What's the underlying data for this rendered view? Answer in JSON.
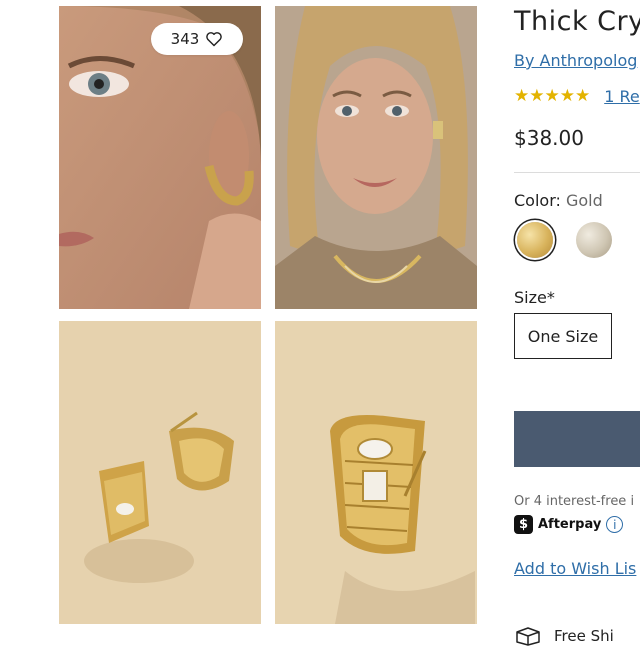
{
  "gallery": {
    "favorite_count": "343",
    "images": [
      {
        "icon": "model-closeup-ear-photo"
      },
      {
        "icon": "model-portrait-photo"
      },
      {
        "icon": "earrings-pair-product-photo"
      },
      {
        "icon": "earring-single-product-photo"
      }
    ]
  },
  "product": {
    "title": "Thick Cry",
    "brand": "By Anthropolog",
    "stars": "★★★★★",
    "reviews": "1 Re",
    "price": "$38.00"
  },
  "options": {
    "color_label": "Color:",
    "color_value": "Gold",
    "swatches": [
      {
        "name": "Gold",
        "selected": true,
        "color": "#d8b35c"
      },
      {
        "name": "Silver",
        "selected": false,
        "color": "#cfc6b3"
      }
    ],
    "size_label": "Size*",
    "size_option": "One Size"
  },
  "purchase": {
    "button_color": "#4a5a70",
    "installments": "Or 4 interest-free i",
    "afterpay_label": "Afterpay",
    "afterpay_badge": "$",
    "info_glyph": "i",
    "wishlist": "Add to Wish Lis",
    "shipping": "Free Shi"
  },
  "colors": {
    "accent_link": "#2f6ea8",
    "star": "#e3b300"
  }
}
